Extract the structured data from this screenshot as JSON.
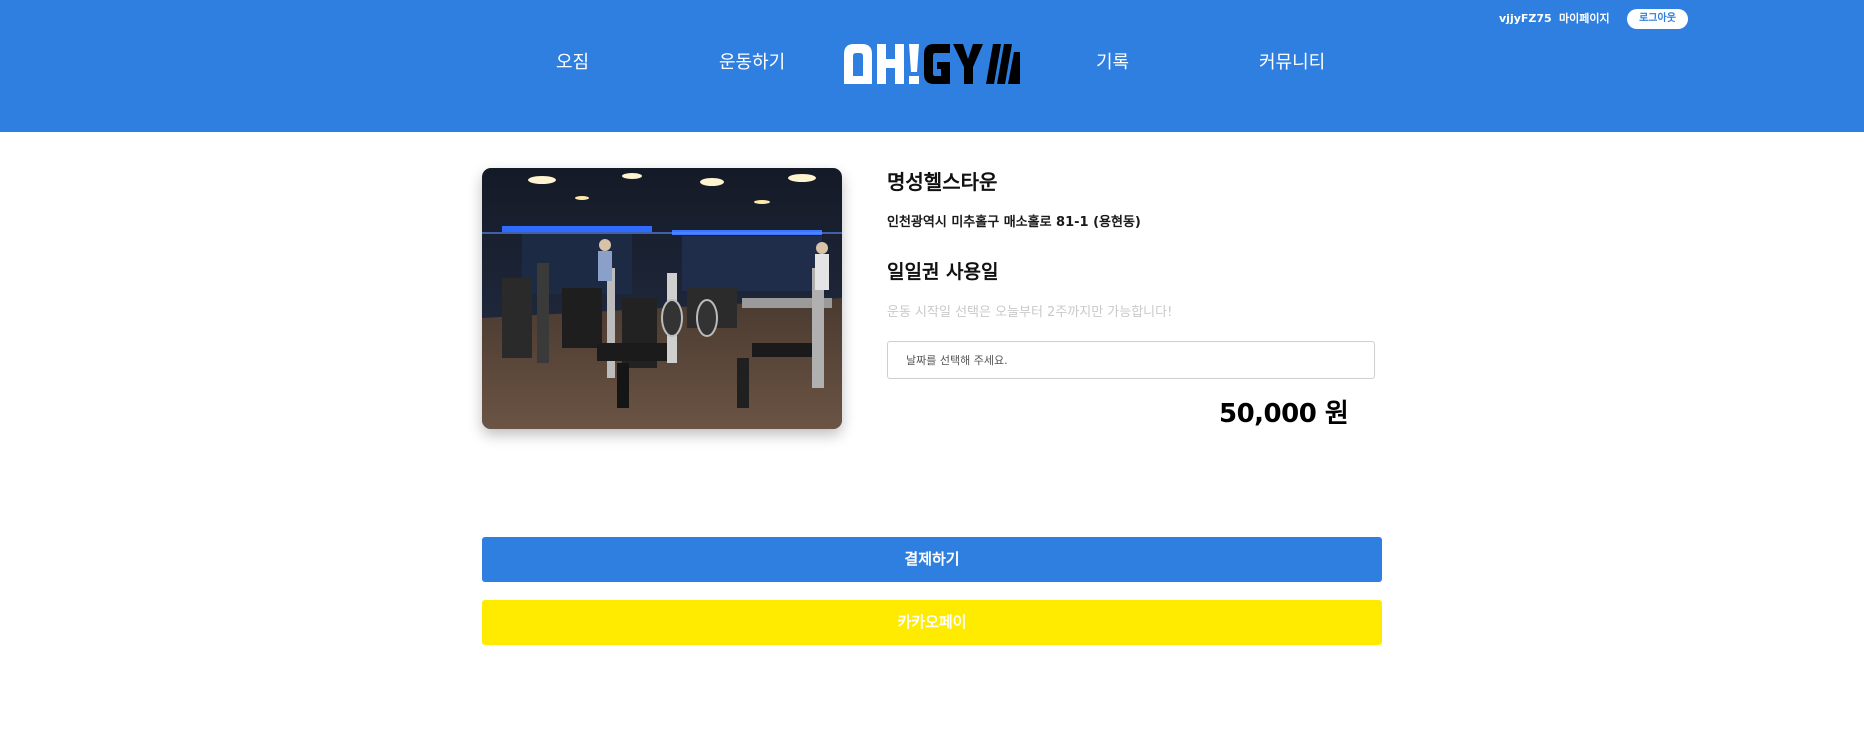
{
  "header": {
    "user_id": "vjjyFZ75",
    "mypage_label": "마이페이지",
    "logout_label": "로그아웃",
    "nav": {
      "ojim": "오짐",
      "workout": "운동하기",
      "record": "기록",
      "community": "커뮤니티"
    },
    "logo_text": "OH!GYM",
    "bg_color": "#2e7fe0"
  },
  "gym": {
    "name": "명성헬스타운",
    "address": "인천광역시 미추홀구 매소홀로 81-1 (용현동)"
  },
  "pass": {
    "title": "일일권 사용일",
    "notice": "운동 시작일 선택은 오늘부터 2주까지만 가능합니다!",
    "date_placeholder": "날짜를 선택해 주세요.",
    "price": "50,000 원"
  },
  "actions": {
    "pay_label": "결제하기",
    "kakao_label": "카카오페이",
    "pay_color": "#2e7fe0",
    "kakao_color": "#ffeb00"
  }
}
